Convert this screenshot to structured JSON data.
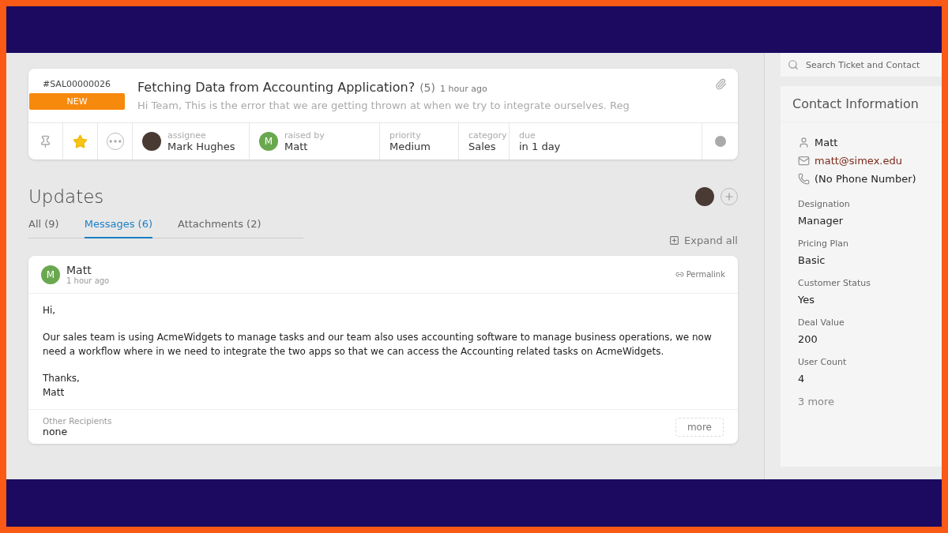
{
  "ticket": {
    "id": "#SAL00000026",
    "status": "NEW",
    "title": "Fetching Data from Accounting Application?",
    "count": "(5)",
    "time": "1 hour ago",
    "preview": "Hi Team, This is the error that we are getting thrown at when we try to integrate ourselves. Reg",
    "starred": true,
    "fields": [
      {
        "kind": "photo",
        "label": "assignee",
        "value": "Mark Hughes"
      },
      {
        "kind": "letter",
        "initial": "M",
        "label": "raised by",
        "value": "Matt"
      },
      {
        "kind": "plain",
        "label": "priority",
        "value": "Medium"
      },
      {
        "kind": "plain",
        "label": "category",
        "value": "Sales"
      },
      {
        "kind": "plain",
        "label": "due",
        "value": "in 1 day"
      }
    ]
  },
  "updates": {
    "title": "Updates",
    "expand_all": "Expand all",
    "tabs": [
      {
        "label": "All (9)",
        "selected": false
      },
      {
        "label": "Messages (6)",
        "selected": true
      },
      {
        "label": "Attachments (2)",
        "selected": false
      }
    ],
    "message": {
      "initial": "M",
      "author": "Matt",
      "time": "1 hour ago",
      "permalink": "Permalink",
      "paragraphs": [
        [
          "Hi,"
        ],
        [
          "Our sales team is using AcmeWidgets to manage tasks and our team also uses accounting software to manage business operations, we now need a workflow where in we need to integrate the two apps so that we can access the Accounting related tasks on AcmeWidgets."
        ],
        [
          "Thanks,",
          "Matt"
        ]
      ],
      "recipients_label": "Other Recipients",
      "recipients": "none",
      "more": "more"
    }
  },
  "sidebar": {
    "search": {
      "placeholder": "Search Ticket and Contact"
    },
    "contact": {
      "title": "Contact Information",
      "details": [
        {
          "kind": "person",
          "text": "Matt"
        },
        {
          "kind": "email",
          "text": "matt@simex.edu"
        },
        {
          "kind": "phone",
          "text": "(No Phone Number)"
        }
      ],
      "fields": [
        {
          "label": "Designation",
          "value": "Manager"
        },
        {
          "label": "Pricing Plan",
          "value": "Basic"
        },
        {
          "label": "Customer Status",
          "value": "Yes"
        },
        {
          "label": "Deal Value",
          "value": "200"
        },
        {
          "label": "User Count",
          "value": "4"
        }
      ],
      "more": "3 more"
    }
  }
}
